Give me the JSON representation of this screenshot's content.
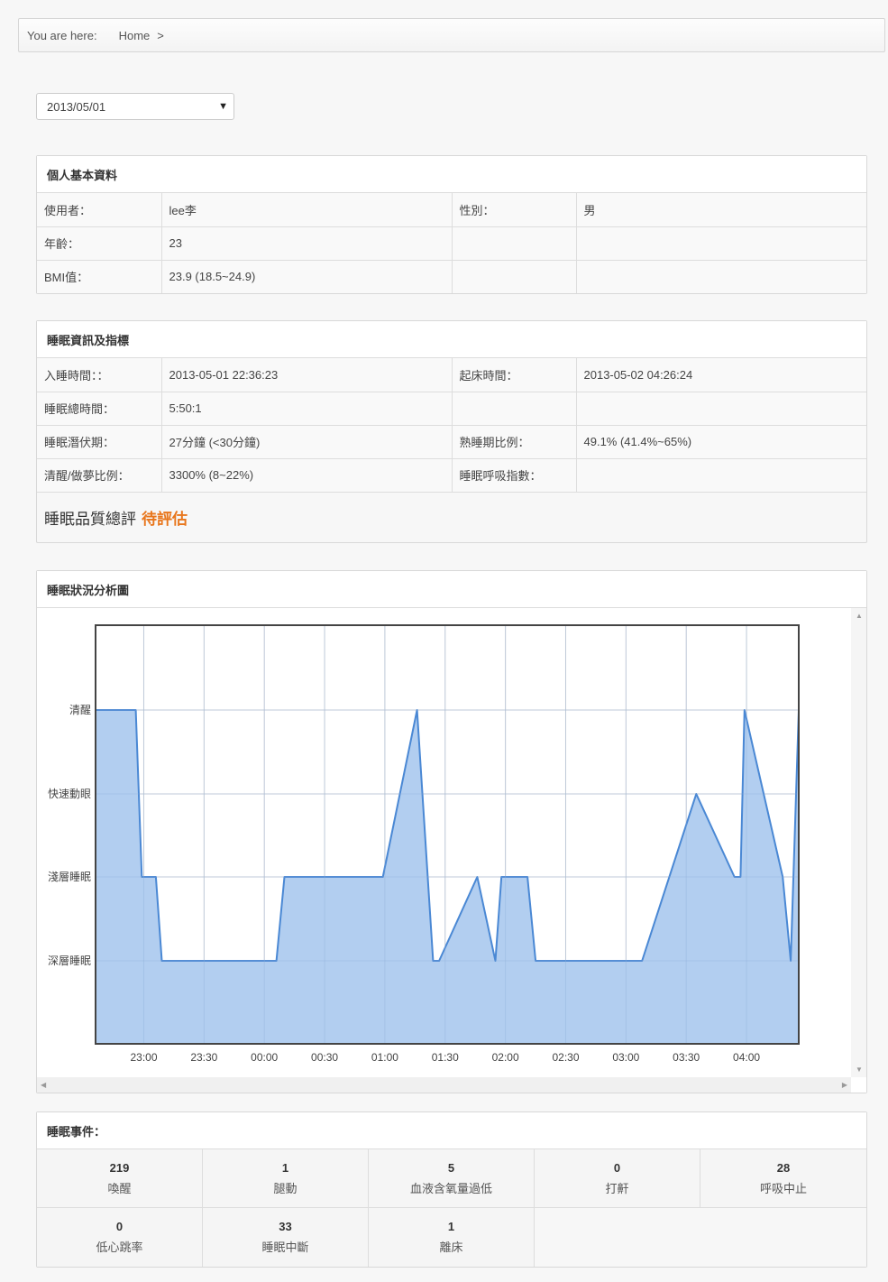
{
  "breadcrumb": {
    "label": "You are here:",
    "home": "Home",
    "separator": ">"
  },
  "date_select": {
    "value": "2013/05/01"
  },
  "profile": {
    "title": "個人基本資料",
    "rows": [
      [
        "使用者：",
        "lee李",
        "性別：",
        "男"
      ],
      [
        "年齡：",
        "23",
        "",
        ""
      ],
      [
        "BMI值：",
        "23.9 (18.5~24.9)",
        "",
        ""
      ]
    ]
  },
  "sleep_info": {
    "title": "睡眠資訊及指標",
    "rows": [
      [
        "入睡時間：：",
        "2013-05-01 22:36:23",
        "起床時間：",
        "2013-05-02 04:26:24"
      ],
      [
        "睡眠總時間：",
        "5:50:1",
        "",
        ""
      ],
      [
        "睡眠潛伏期：",
        "27分鐘 (<30分鐘)",
        "熟睡期比例：",
        "49.1% (41.4%~65%)"
      ],
      [
        "清醒/做夢比例：",
        "3300% (8~22%)",
        "睡眠呼吸指數：",
        ""
      ]
    ],
    "quality_label": "睡眠品質總評",
    "quality_value": "待評估"
  },
  "chart_title": "睡眠狀況分析圖",
  "chart_data": {
    "type": "area",
    "title": "",
    "xlabel": "",
    "ylabel": "",
    "x_ticks": [
      "23:00",
      "23:30",
      "00:00",
      "00:30",
      "01:00",
      "01:30",
      "02:00",
      "02:30",
      "03:00",
      "03:30",
      "04:00"
    ],
    "y_categories": [
      "深層睡眠",
      "淺層睡眠",
      "快速動眼",
      "清醒"
    ],
    "xlim": [
      "22:36",
      "04:26"
    ],
    "grid": true,
    "color": "#4a88d4",
    "fill": "#aecbef",
    "points": [
      [
        "22:36",
        "清醒"
      ],
      [
        "22:56",
        "清醒"
      ],
      [
        "22:59",
        "淺層睡眠"
      ],
      [
        "23:06",
        "淺層睡眠"
      ],
      [
        "23:09",
        "深層睡眠"
      ],
      [
        "00:06",
        "深層睡眠"
      ],
      [
        "00:10",
        "淺層睡眠"
      ],
      [
        "00:59",
        "淺層睡眠"
      ],
      [
        "01:16",
        "清醒"
      ],
      [
        "01:24",
        "深層睡眠"
      ],
      [
        "01:27",
        "深層睡眠"
      ],
      [
        "01:46",
        "淺層睡眠"
      ],
      [
        "01:55",
        "深層睡眠"
      ],
      [
        "01:58",
        "淺層睡眠"
      ],
      [
        "02:11",
        "淺層睡眠"
      ],
      [
        "02:15",
        "深層睡眠"
      ],
      [
        "03:08",
        "深層睡眠"
      ],
      [
        "03:35",
        "快速動眼"
      ],
      [
        "03:54",
        "淺層睡眠"
      ],
      [
        "03:57",
        "淺層睡眠"
      ],
      [
        "03:59",
        "清醒"
      ],
      [
        "04:18",
        "淺層睡眠"
      ],
      [
        "04:22",
        "深層睡眠"
      ],
      [
        "04:26",
        "清醒"
      ]
    ]
  },
  "events": {
    "title": "睡眠事件：",
    "items": [
      {
        "value": "219",
        "label": "喚醒"
      },
      {
        "value": "1",
        "label": "腿動"
      },
      {
        "value": "5",
        "label": "血液含氧量過低"
      },
      {
        "value": "0",
        "label": "打鼾"
      },
      {
        "value": "28",
        "label": "呼吸中止"
      },
      {
        "value": "0",
        "label": "低心跳率"
      },
      {
        "value": "33",
        "label": "睡眠中斷"
      },
      {
        "value": "1",
        "label": "離床"
      }
    ]
  }
}
